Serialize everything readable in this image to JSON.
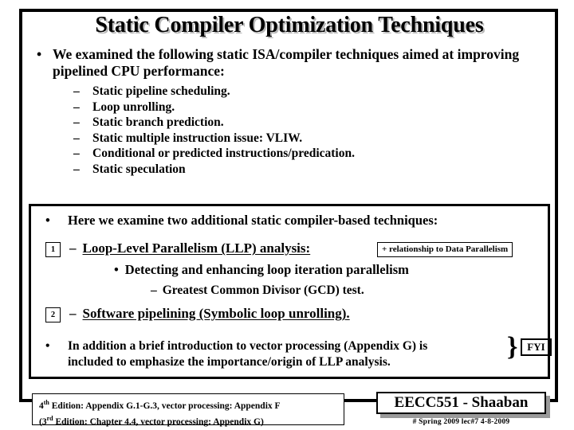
{
  "slide": {
    "title": "Static Compiler Optimization Techniques",
    "top_section": {
      "bullet": "We examined the following static ISA/compiler techniques aimed at improving pipelined CPU performance:",
      "bullet_marker": "•",
      "dash_marker": "–",
      "items": [
        "Static pipeline scheduling.",
        "Loop unrolling.",
        "Static branch prediction.",
        "Static multiple instruction issue:  VLIW.",
        "Conditional or predicted instructions/predication.",
        "Static speculation"
      ]
    },
    "inner_section": {
      "intro_bullet": "Here we examine two additional static compiler-based techniques:",
      "bullet_marker": "•",
      "dash_marker": "–",
      "item1": {
        "number": "1",
        "text": "Loop-Level Parallelism (LLP) analysis:",
        "callout": "+ relationship to Data Parallelism"
      },
      "item1_sub": {
        "marker": "•",
        "text": "Detecting and enhancing loop iteration parallelism"
      },
      "item1_subsub": {
        "marker": "–",
        "text": "Greatest Common Divisor (GCD) test."
      },
      "item2": {
        "number": "2",
        "text": "Software pipelining (Symbolic loop unrolling)."
      },
      "closing_bullet": {
        "line1": "In addition a brief introduction to vector processing (Appendix G) is",
        "line2": "included to emphasize the importance/origin of LLP analysis.",
        "brace": "}",
        "badge": "FYI"
      }
    },
    "footer": {
      "reference": {
        "line1_pre": "4",
        "line1_sup": "th",
        "line1_post": " Edition: Appendix G.1-G.3, vector processing: Appendix F",
        "line2_pre": "(3",
        "line2_sup": "rd",
        "line2_post": " Edition: Chapter 4.4, vector processing:  Appendix G)"
      },
      "course": "EECC551 - Shaaban",
      "course_sub": "#   Spring 2009  lec#7    4-8-2009"
    }
  }
}
